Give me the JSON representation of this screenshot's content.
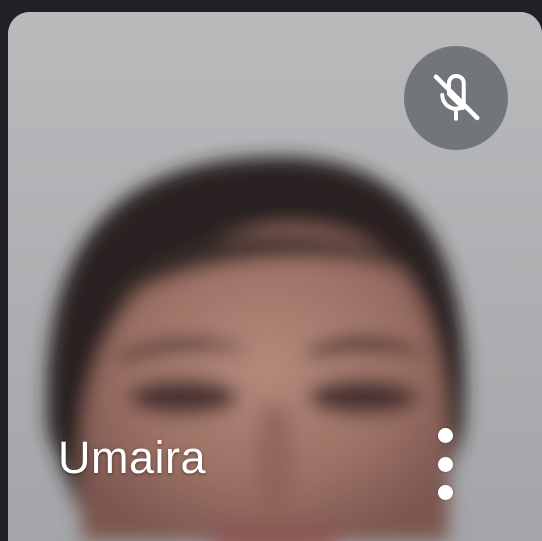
{
  "participant": {
    "name": "Umaira",
    "muted": true
  },
  "icons": {
    "mute": "mic-off-icon",
    "more": "more-vert-icon"
  },
  "colors": {
    "background": "#202124",
    "tile_background": "#abadb0",
    "indicator_background": "#5f6368",
    "name_text": "#ffffff"
  }
}
